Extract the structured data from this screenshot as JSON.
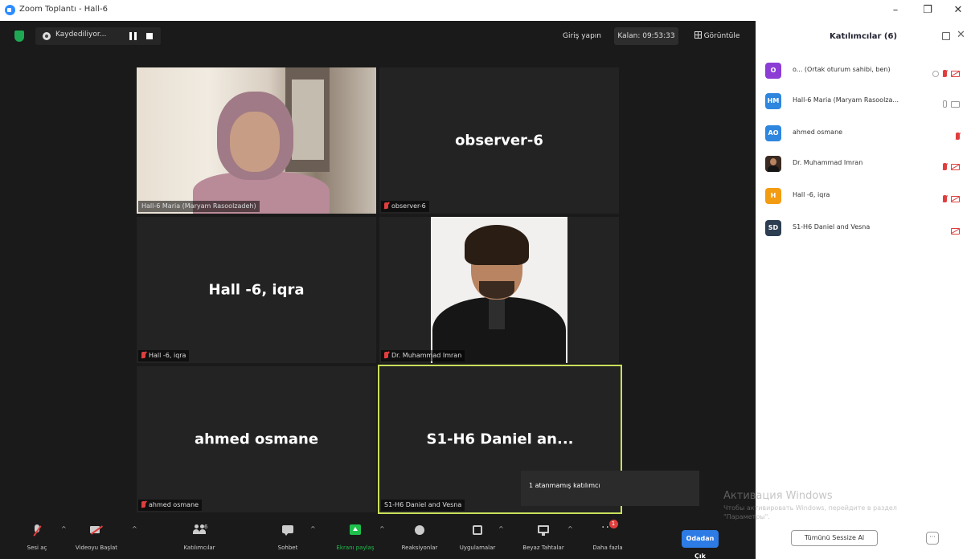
{
  "window": {
    "title": "Zoom Toplantı - Hall-6",
    "minimize": "–",
    "restore": "❐",
    "close": "✕"
  },
  "topbar": {
    "recording_label": "Kaydediliyor...",
    "join_audio": "Giriş yapın",
    "timer": "Kalan: 09:53:33",
    "view_label": "Görüntüle"
  },
  "tiles": [
    {
      "nameplate": "Hall-6 Maria (Maryam Rasoolzadeh)",
      "center_name": "",
      "muted": false
    },
    {
      "nameplate": "observer-6",
      "center_name": "observer-6",
      "muted": true
    },
    {
      "nameplate": "Hall -6, iqra",
      "center_name": "Hall -6, iqra",
      "muted": true
    },
    {
      "nameplate": "Dr. Muhammad Imran",
      "center_name": "",
      "muted": true
    },
    {
      "nameplate": "ahmed osmane",
      "center_name": "ahmed osmane",
      "muted": true
    },
    {
      "nameplate": "S1-H6 Daniel and Vesna",
      "center_name": "S1-H6 Daniel an...",
      "muted": false
    }
  ],
  "tooltip": "1 atanmamış katılımcı",
  "toolbar": {
    "mute": "Sesi aç",
    "video": "Videoyu Başlat",
    "participants": "Katılımcılar",
    "participants_count": "6",
    "chat": "Sohbet",
    "share": "Ekranı paylaş",
    "reactions": "Reaksiyonlar",
    "apps": "Uygulamalar",
    "whiteboard": "Beyaz Tahtalar",
    "more": "Daha fazla",
    "more_badge": "1",
    "leave": "Odadan Çık"
  },
  "panel": {
    "title": "Katılımcılar (6)",
    "participants": [
      {
        "initials": "O",
        "color": "#8b3dd6",
        "name": "o... (Ortak oturum sahibi, ben)"
      },
      {
        "initials": "HM",
        "color": "#2e86de",
        "name": "Hall-6 Maria (Maryam Rasoolza..."
      },
      {
        "initials": "AO",
        "color": "#2e86de",
        "name": "ahmed osmane"
      },
      {
        "initials": "",
        "color": "#3b2a22",
        "name": "Dr. Muhammad Imran"
      },
      {
        "initials": "H",
        "color": "#f39c12",
        "name": "Hall -6, iqra"
      },
      {
        "initials": "SD",
        "color": "#2c3e50",
        "name": "S1-H6 Daniel and Vesna"
      }
    ],
    "mute_all": "Tümünü Sessize Al",
    "more_button": "···"
  },
  "activation": {
    "title": "Активация Windows",
    "text": "Чтобы активировать Windows, перейдите в раздел \"Параметры\"."
  },
  "colors": {
    "meeting_bg": "#1a1a1a",
    "tile_bg": "#232323",
    "active_speaker": "#c8e05a",
    "share_green": "#1fbf4c",
    "leave_blue": "#2d7be5",
    "muted_red": "#e03e3e"
  }
}
